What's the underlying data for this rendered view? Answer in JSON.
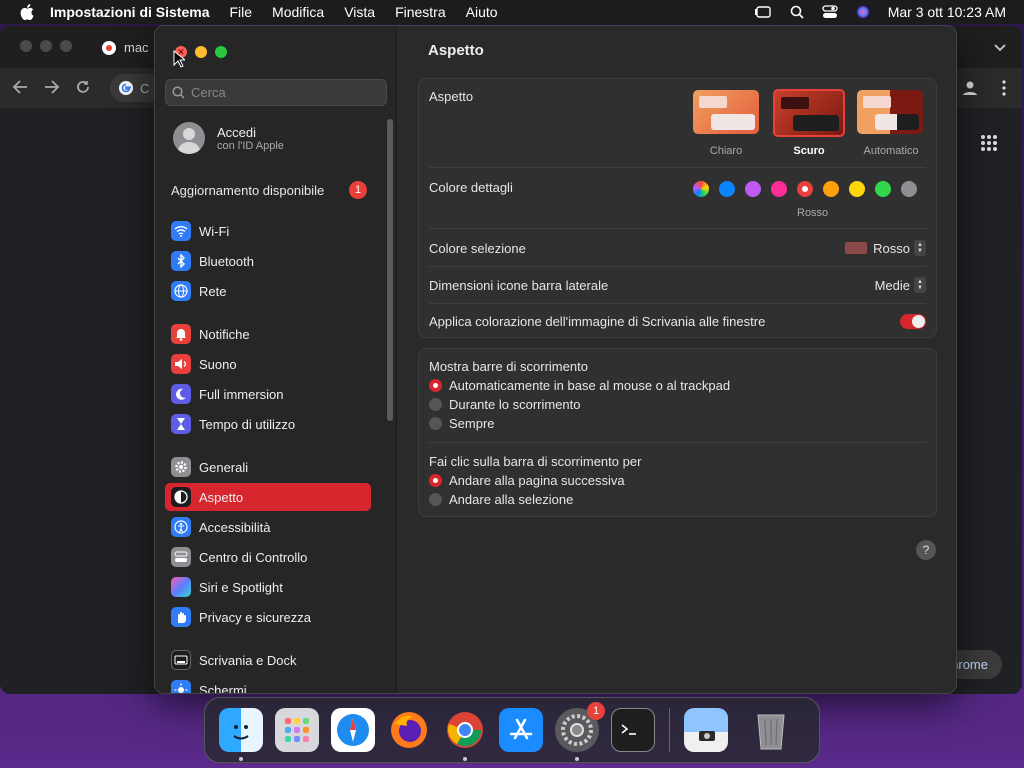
{
  "menubar": {
    "app": "Impostazioni di Sistema",
    "items": [
      "File",
      "Modifica",
      "Vista",
      "Finestra",
      "Aiuto"
    ],
    "clock": "Mar 3 ott  10:23 AM"
  },
  "chrome": {
    "tab_title": "mac",
    "omni_text": "C",
    "bottom_button": "hrome"
  },
  "sidebar": {
    "search_placeholder": "Cerca",
    "account_title": "Accedi",
    "account_subtitle": "con l'ID Apple",
    "update_label": "Aggiornamento disponibile",
    "update_badge": "1",
    "items": [
      {
        "label": "Wi-Fi",
        "color": "#2f7cf6"
      },
      {
        "label": "Bluetooth",
        "color": "#2f7cf6"
      },
      {
        "label": "Rete",
        "color": "#2f7cf6"
      },
      {
        "label": "Notifiche",
        "color": "#e8413c"
      },
      {
        "label": "Suono",
        "color": "#e8413c"
      },
      {
        "label": "Full immersion",
        "color": "#5e5ce6"
      },
      {
        "label": "Tempo di utilizzo",
        "color": "#5e5ce6"
      },
      {
        "label": "Generali",
        "color": "#8e8e93"
      },
      {
        "label": "Aspetto",
        "color": "#1c1c1e"
      },
      {
        "label": "Accessibilità",
        "color": "#2f7cf6"
      },
      {
        "label": "Centro di Controllo",
        "color": "#8e8e93"
      },
      {
        "label": "Siri e Spotlight",
        "color": "#8b3fd9"
      },
      {
        "label": "Privacy e sicurezza",
        "color": "#2f7cf6"
      },
      {
        "label": "Scrivania e Dock",
        "color": "#1c1c1e"
      },
      {
        "label": "Schermi",
        "color": "#2f7cf6"
      }
    ]
  },
  "main": {
    "title": "Aspetto",
    "appearance_label": "Aspetto",
    "appearance_options": [
      "Chiaro",
      "Scuro",
      "Automatico"
    ],
    "appearance_selected": "Scuro",
    "accent_label": "Colore dettagli",
    "accent_colors": [
      "multicolor",
      "#0a84ff",
      "#bf5af2",
      "#ff2d95",
      "#e8413c",
      "#ff9f0a",
      "#ffd60a",
      "#32d74b",
      "#8e8e93"
    ],
    "accent_selected_name": "Rosso",
    "highlight_label": "Colore selezione",
    "highlight_value": "Rosso",
    "sidebar_icon_label": "Dimensioni icone barra laterale",
    "sidebar_icon_value": "Medie",
    "tint_label": "Applica colorazione dell'immagine di Scrivania alle finestre",
    "tint_on": true,
    "scrollbars_label": "Mostra barre di scorrimento",
    "scrollbars_options": [
      "Automaticamente in base al mouse o al trackpad",
      "Durante lo scorrimento",
      "Sempre"
    ],
    "scrollbars_selected": 0,
    "click_label": "Fai clic sulla barra di scorrimento per",
    "click_options": [
      "Andare alla pagina successiva",
      "Andare alla selezione"
    ],
    "click_selected": 0,
    "help": "?"
  },
  "dock": {
    "apps": [
      "finder",
      "launchpad",
      "safari",
      "firefox",
      "chrome",
      "app-store",
      "system-settings",
      "terminal",
      "preview",
      "trash"
    ],
    "settings_badge": "1"
  }
}
